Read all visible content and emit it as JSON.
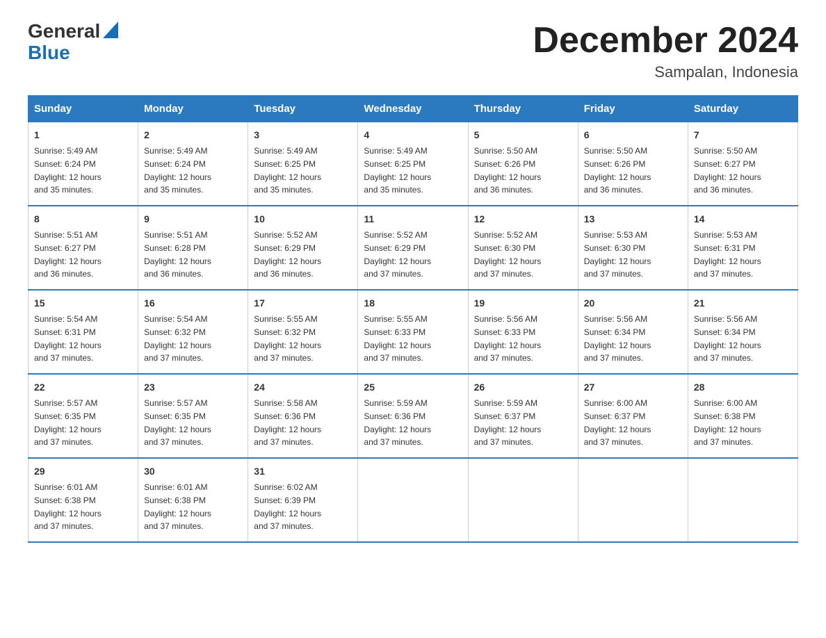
{
  "logo": {
    "general": "General",
    "blue": "Blue"
  },
  "header": {
    "month_year": "December 2024",
    "location": "Sampalan, Indonesia"
  },
  "weekdays": [
    "Sunday",
    "Monday",
    "Tuesday",
    "Wednesday",
    "Thursday",
    "Friday",
    "Saturday"
  ],
  "weeks": [
    [
      {
        "day": "1",
        "sunrise": "5:49 AM",
        "sunset": "6:24 PM",
        "daylight": "12 hours and 35 minutes."
      },
      {
        "day": "2",
        "sunrise": "5:49 AM",
        "sunset": "6:24 PM",
        "daylight": "12 hours and 35 minutes."
      },
      {
        "day": "3",
        "sunrise": "5:49 AM",
        "sunset": "6:25 PM",
        "daylight": "12 hours and 35 minutes."
      },
      {
        "day": "4",
        "sunrise": "5:49 AM",
        "sunset": "6:25 PM",
        "daylight": "12 hours and 35 minutes."
      },
      {
        "day": "5",
        "sunrise": "5:50 AM",
        "sunset": "6:26 PM",
        "daylight": "12 hours and 36 minutes."
      },
      {
        "day": "6",
        "sunrise": "5:50 AM",
        "sunset": "6:26 PM",
        "daylight": "12 hours and 36 minutes."
      },
      {
        "day": "7",
        "sunrise": "5:50 AM",
        "sunset": "6:27 PM",
        "daylight": "12 hours and 36 minutes."
      }
    ],
    [
      {
        "day": "8",
        "sunrise": "5:51 AM",
        "sunset": "6:27 PM",
        "daylight": "12 hours and 36 minutes."
      },
      {
        "day": "9",
        "sunrise": "5:51 AM",
        "sunset": "6:28 PM",
        "daylight": "12 hours and 36 minutes."
      },
      {
        "day": "10",
        "sunrise": "5:52 AM",
        "sunset": "6:29 PM",
        "daylight": "12 hours and 36 minutes."
      },
      {
        "day": "11",
        "sunrise": "5:52 AM",
        "sunset": "6:29 PM",
        "daylight": "12 hours and 37 minutes."
      },
      {
        "day": "12",
        "sunrise": "5:52 AM",
        "sunset": "6:30 PM",
        "daylight": "12 hours and 37 minutes."
      },
      {
        "day": "13",
        "sunrise": "5:53 AM",
        "sunset": "6:30 PM",
        "daylight": "12 hours and 37 minutes."
      },
      {
        "day": "14",
        "sunrise": "5:53 AM",
        "sunset": "6:31 PM",
        "daylight": "12 hours and 37 minutes."
      }
    ],
    [
      {
        "day": "15",
        "sunrise": "5:54 AM",
        "sunset": "6:31 PM",
        "daylight": "12 hours and 37 minutes."
      },
      {
        "day": "16",
        "sunrise": "5:54 AM",
        "sunset": "6:32 PM",
        "daylight": "12 hours and 37 minutes."
      },
      {
        "day": "17",
        "sunrise": "5:55 AM",
        "sunset": "6:32 PM",
        "daylight": "12 hours and 37 minutes."
      },
      {
        "day": "18",
        "sunrise": "5:55 AM",
        "sunset": "6:33 PM",
        "daylight": "12 hours and 37 minutes."
      },
      {
        "day": "19",
        "sunrise": "5:56 AM",
        "sunset": "6:33 PM",
        "daylight": "12 hours and 37 minutes."
      },
      {
        "day": "20",
        "sunrise": "5:56 AM",
        "sunset": "6:34 PM",
        "daylight": "12 hours and 37 minutes."
      },
      {
        "day": "21",
        "sunrise": "5:56 AM",
        "sunset": "6:34 PM",
        "daylight": "12 hours and 37 minutes."
      }
    ],
    [
      {
        "day": "22",
        "sunrise": "5:57 AM",
        "sunset": "6:35 PM",
        "daylight": "12 hours and 37 minutes."
      },
      {
        "day": "23",
        "sunrise": "5:57 AM",
        "sunset": "6:35 PM",
        "daylight": "12 hours and 37 minutes."
      },
      {
        "day": "24",
        "sunrise": "5:58 AM",
        "sunset": "6:36 PM",
        "daylight": "12 hours and 37 minutes."
      },
      {
        "day": "25",
        "sunrise": "5:59 AM",
        "sunset": "6:36 PM",
        "daylight": "12 hours and 37 minutes."
      },
      {
        "day": "26",
        "sunrise": "5:59 AM",
        "sunset": "6:37 PM",
        "daylight": "12 hours and 37 minutes."
      },
      {
        "day": "27",
        "sunrise": "6:00 AM",
        "sunset": "6:37 PM",
        "daylight": "12 hours and 37 minutes."
      },
      {
        "day": "28",
        "sunrise": "6:00 AM",
        "sunset": "6:38 PM",
        "daylight": "12 hours and 37 minutes."
      }
    ],
    [
      {
        "day": "29",
        "sunrise": "6:01 AM",
        "sunset": "6:38 PM",
        "daylight": "12 hours and 37 minutes."
      },
      {
        "day": "30",
        "sunrise": "6:01 AM",
        "sunset": "6:38 PM",
        "daylight": "12 hours and 37 minutes."
      },
      {
        "day": "31",
        "sunrise": "6:02 AM",
        "sunset": "6:39 PM",
        "daylight": "12 hours and 37 minutes."
      },
      null,
      null,
      null,
      null
    ]
  ],
  "labels": {
    "sunrise": "Sunrise:",
    "sunset": "Sunset:",
    "daylight": "Daylight:"
  }
}
